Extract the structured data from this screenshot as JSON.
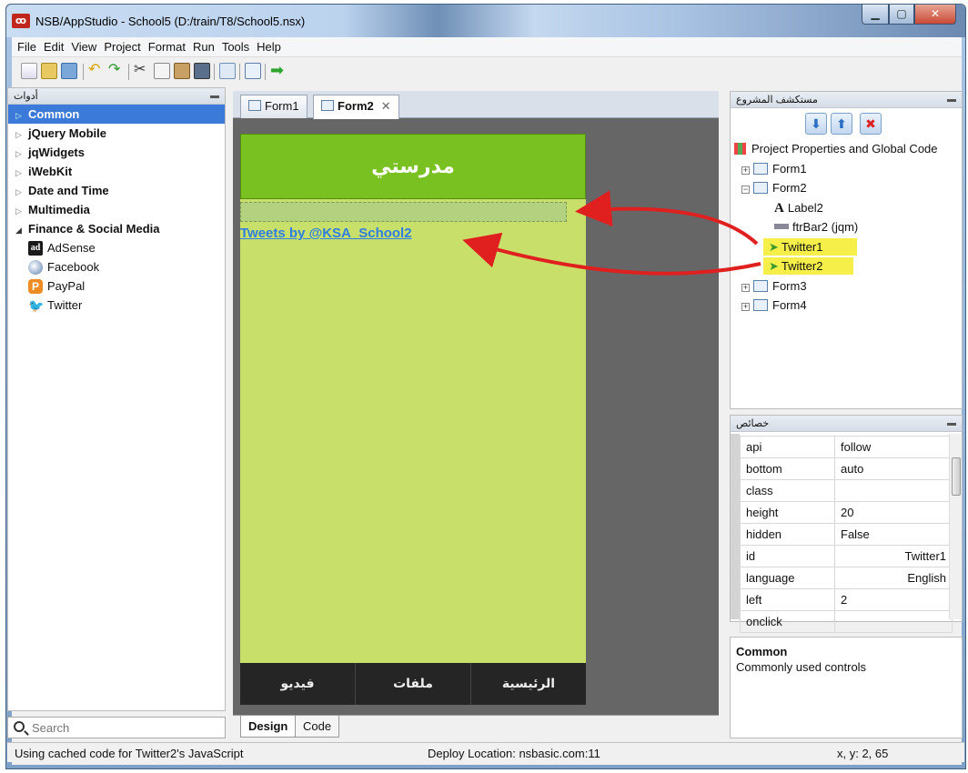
{
  "window": {
    "title": "NSB/AppStudio - School5 (D:/train/T8/School5.nsx)"
  },
  "menu": [
    "File",
    "Edit",
    "View",
    "Project",
    "Format",
    "Run",
    "Tools",
    "Help"
  ],
  "toolbox": {
    "title": "أدوات",
    "categories": [
      {
        "label": "Common",
        "selected": true
      },
      {
        "label": "jQuery Mobile"
      },
      {
        "label": "jqWidgets"
      },
      {
        "label": "iWebKit"
      },
      {
        "label": "Date and Time"
      },
      {
        "label": "Multimedia"
      },
      {
        "label": "Finance & Social Media",
        "expanded": true
      }
    ],
    "items": [
      "AdSense",
      "Facebook",
      "PayPal",
      "Twitter"
    ],
    "search_placeholder": "Search"
  },
  "editor": {
    "tabs": [
      "Form1",
      "Form2"
    ],
    "active_tab": "Form2",
    "bottom_tabs": [
      "Design",
      "Code"
    ],
    "form": {
      "header_title": "مدرستي",
      "tweet_link": "Tweets by @KSA_School2",
      "footer_buttons": [
        "فيديو",
        "ملفات",
        "الرئيسية"
      ]
    }
  },
  "project_explorer": {
    "title": "مستكشف المشروع",
    "root": "Project Properties and Global Code",
    "nodes": [
      "Form1",
      "Form2",
      "Label2",
      "ftrBar2 (jqm)",
      "Twitter1",
      "Twitter2",
      "Form3",
      "Form4"
    ]
  },
  "properties": {
    "title": "خصائص",
    "rows": [
      {
        "key": "api",
        "value": "follow"
      },
      {
        "key": "bottom",
        "value": "auto"
      },
      {
        "key": "class",
        "value": ""
      },
      {
        "key": "height",
        "value": "20"
      },
      {
        "key": "hidden",
        "value": "False"
      },
      {
        "key": "id",
        "value": "Twitter1"
      },
      {
        "key": "language",
        "value": "English"
      },
      {
        "key": "left",
        "value": "2"
      },
      {
        "key": "onclick",
        "value": ""
      }
    ]
  },
  "help": {
    "title": "Common",
    "description": "Commonly used controls"
  },
  "status": {
    "left": "Using cached code for Twitter2's JavaScript",
    "middle": "Deploy Location: nsbasic.com:11",
    "right": "x, y: 2, 65"
  },
  "colors": {
    "header_green": "#79c021",
    "body_green": "#c8e06a",
    "footer": "#252525",
    "highlight": "#f6ef4a",
    "arrow": "#e01f1f"
  }
}
